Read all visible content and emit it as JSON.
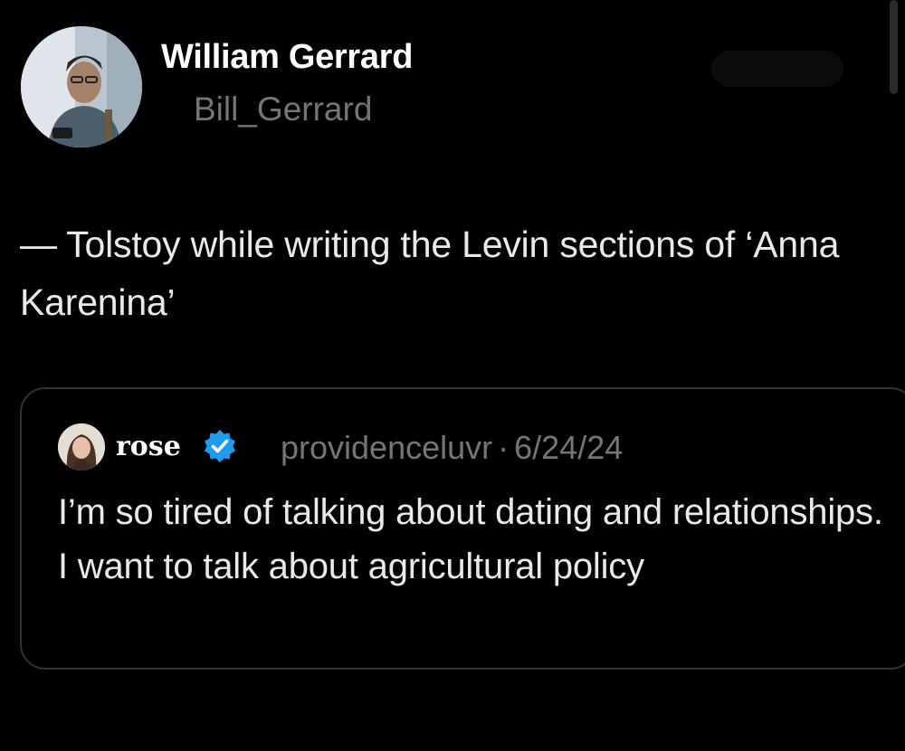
{
  "author": {
    "name": "William Gerrard",
    "handle": "Bill_Gerrard",
    "avatar_icon": "profile-photo"
  },
  "tweet": {
    "text": "— Tolstoy while writing the Levin sections of ‘Anna Karenina’"
  },
  "quoted_tweet": {
    "author_name": "rose",
    "verified": true,
    "verified_color": "#1d9bf0",
    "handle": "providenceluvr",
    "separator": "·",
    "date": "6/24/24",
    "text": "I’m so tired of talking about dating and relationships. I want to talk about agricultural policy",
    "avatar_icon": "profile-photo"
  },
  "colors": {
    "background": "#000000",
    "primary_text": "#e7e9ea",
    "secondary_text": "#71767b",
    "card_border": "#2f3336"
  }
}
